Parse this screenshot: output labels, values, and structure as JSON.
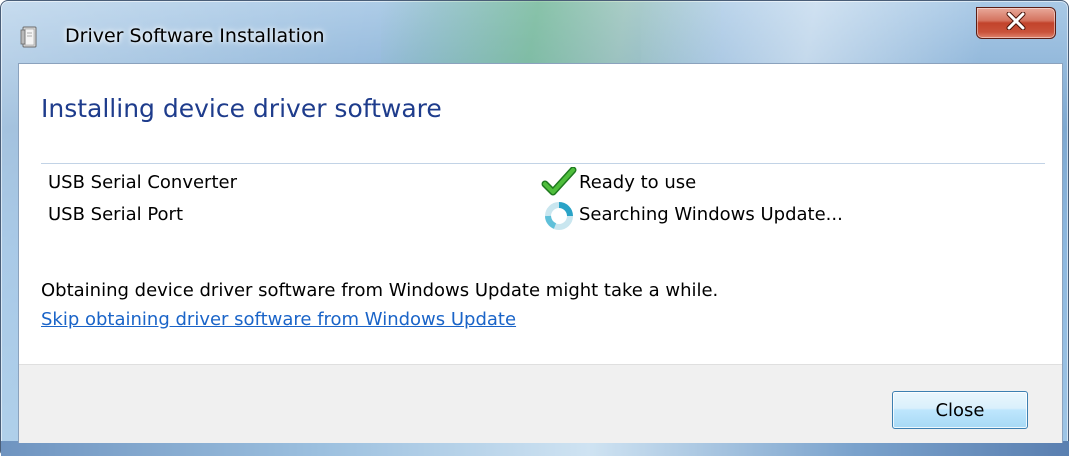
{
  "window": {
    "title": "Driver Software Installation",
    "title_icon": "driver-installer-icon",
    "close_icon": "close-x-icon"
  },
  "main": {
    "heading": "Installing device driver software",
    "devices": [
      {
        "name": "USB Serial Converter",
        "status": "Ready to use",
        "status_icon": "green-checkmark-icon"
      },
      {
        "name": "USB Serial Port",
        "status": "Searching Windows Update...",
        "status_icon": "busy-ring-icon"
      }
    ],
    "info": "Obtaining device driver software from Windows Update might take a while.",
    "skip_link": "Skip obtaining driver software from Windows Update"
  },
  "footer": {
    "close_label": "Close"
  },
  "colors": {
    "heading": "#1e3c8c",
    "link": "#1a64c8",
    "check": "#2e9a2e",
    "close_x_bg": "#c2432b"
  }
}
